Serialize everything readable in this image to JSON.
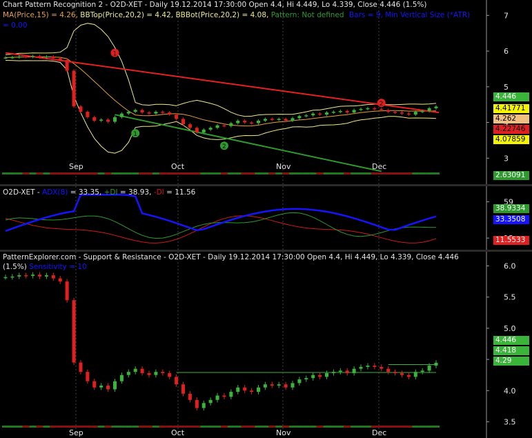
{
  "colors": {
    "background": "#000000",
    "up_candle": "#3ab53a",
    "down_candle": "#e02020",
    "ma": "#e6a040",
    "bollinger": "#f0ec8c",
    "upper_trendline": "#e62020",
    "lower_trendline": "#2e9a2e",
    "adx": "#1414ff",
    "plus_di": "#2e9a2e",
    "minus_di": "#d01818"
  },
  "pane1": {
    "title": "Chart Pattern Recognition 2 - O2D-XET - Daily 19.12.2014 17:30:00 Open 4.4, Hi 4.449, Lo 4.339, Close 4.446 (1.5%)",
    "ma_label": "MA(Price,15) = 4.26,",
    "bbtop_label": "BBTop(Price,20,2) = 4.42,",
    "bbbot_label": "BBBot(Price,20,2) = 4.08,",
    "pattern_label": "Pattern: Not defined",
    "bars_label": "Bars = 9, Min Vertical Size (*ATR)",
    "bars_value": "= 0.00",
    "y_ticks": [
      "7",
      "6",
      "5",
      "4",
      "3"
    ],
    "markers": [
      "1",
      "2",
      "1",
      "2"
    ],
    "price_tags": [
      {
        "text": "4.446",
        "bg": "#3ab53a",
        "fg": "#ffffff"
      },
      {
        "text": "4.41771",
        "bg": "#f4f400",
        "fg": "#000000"
      },
      {
        "text": "4.262",
        "bg": "#f0c080",
        "fg": "#000000"
      },
      {
        "text": "4.22746",
        "bg": "#e02020",
        "fg": "#000000"
      },
      {
        "text": "4.07859",
        "bg": "#f4f400",
        "fg": "#000000"
      },
      {
        "text": "2.63091",
        "bg": "#2e9a2e",
        "fg": "#ffffff"
      }
    ]
  },
  "pane2": {
    "symbol_label": "O2D-XET -",
    "adx_label": "ADX(8)",
    "adx_value": "= 33.35,",
    "plus_di_label": "+DI",
    "plus_di_value": "= 38.93,",
    "minus_di_label": "-DI",
    "minus_di_value": "= 11.56",
    "y_ticks": [
      "59",
      "13"
    ],
    "tags": [
      {
        "text": "38.9334",
        "bg": "#2e9a2e",
        "fg": "#ffffff"
      },
      {
        "text": "33.3508",
        "bg": "#1414ff",
        "fg": "#ffffff"
      },
      {
        "text": "11.5533",
        "bg": "#e02020",
        "fg": "#ffffff"
      }
    ]
  },
  "pane3": {
    "title": "PatternExplorer.com - Support & Resistance - O2D-XET - Daily 19.12.2014 17:30:00 Open 4.4, Hi 4.449, Lo 4.339, Close 4.446",
    "title_line2": "(1.5%)",
    "sensitivity_label": "Sensitivity = 10",
    "y_ticks": [
      "6.0",
      "5.5",
      "5.0",
      "4.5",
      "4.0",
      "3.5"
    ],
    "tags": [
      {
        "text": "4.446",
        "bg": "#3ab53a",
        "fg": "#ffffff"
      },
      {
        "text": "4.418",
        "bg": "#3ab53a",
        "fg": "#ffffff"
      },
      {
        "text": "4.29",
        "bg": "#3ab53a",
        "fg": "#ffffff"
      }
    ]
  },
  "x_axis": {
    "months": [
      "Sep",
      "Oct",
      "Nov",
      "Dec"
    ]
  },
  "chart_data": {
    "type": "candlestick",
    "title": "Chart Pattern Recognition 2 - O2D-XET - Daily 19.12.2014 17:30:00 Open 4.4, Hi 4.449, Lo 4.339, Close 4.446 (1.5%)",
    "x_months": [
      "Sep",
      "Oct",
      "Nov",
      "Dec"
    ],
    "closes": [
      5.82,
      5.83,
      5.85,
      5.84,
      5.86,
      5.83,
      5.85,
      5.8,
      5.75,
      5.45,
      4.45,
      4.3,
      4.15,
      4.05,
      4.08,
      4.02,
      4.15,
      4.25,
      4.3,
      4.35,
      4.28,
      4.25,
      4.3,
      4.28,
      4.22,
      4.1,
      3.95,
      3.85,
      3.72,
      3.8,
      3.85,
      3.92,
      3.9,
      3.98,
      4.05,
      4.0,
      3.98,
      4.05,
      4.1,
      4.08,
      4.1,
      4.05,
      4.12,
      4.18,
      4.2,
      4.25,
      4.22,
      4.28,
      4.3,
      4.32,
      4.28,
      4.35,
      4.38,
      4.4,
      4.38,
      4.35,
      4.3,
      4.28,
      4.25,
      4.22,
      4.3,
      4.32,
      4.4,
      4.446
    ],
    "ylim": [
      2.6,
      7.2
    ]
  }
}
